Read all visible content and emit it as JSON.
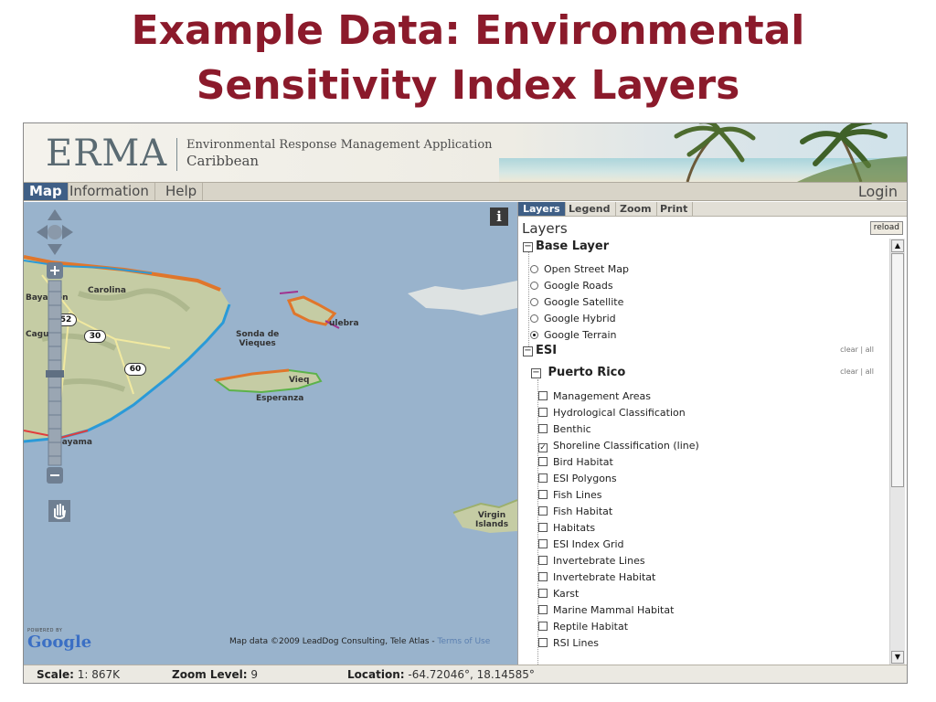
{
  "slide": {
    "title_line1": "Example Data: Environmental",
    "title_line2": "Sensitivity Index Layers"
  },
  "header": {
    "logo": "ERMA",
    "subtitle_line1": "Environmental Response Management Application",
    "subtitle_line2": "Caribbean"
  },
  "nav": {
    "tabs": [
      {
        "label": "Map",
        "active": true
      },
      {
        "label": "Information",
        "active": false
      },
      {
        "label": "Help",
        "active": false
      }
    ],
    "login": "Login"
  },
  "map": {
    "labels": {
      "carolina": "Carolina",
      "bayamon": "Bayamón",
      "caguas": "Caguas",
      "guayama": "Guayama",
      "sonda": "Sonda de",
      "vieques_water": "Vieques",
      "culebra": "ulebra",
      "vieques_island": "Vieq",
      "esperanza": "Esperanza",
      "virgin": "Virgin",
      "islands": "Islands"
    },
    "shields": {
      "r52": "52",
      "r30": "30",
      "r60": "60"
    },
    "attribution": "Map data ©2009 LeadDog Consulting, Tele Atlas - ",
    "terms": "Terms of Use",
    "powered_by": "POWERED BY",
    "google": "Google",
    "info": "i",
    "colors": {
      "water": "#99b3cc",
      "land": "#c9cfa9",
      "accent": "#3f5f86"
    }
  },
  "panel": {
    "tabs": [
      {
        "label": "Layers",
        "active": true
      },
      {
        "label": "Legend",
        "active": false
      },
      {
        "label": "Zoom",
        "active": false
      },
      {
        "label": "Print",
        "active": false
      }
    ],
    "title": "Layers",
    "reload": "reload",
    "base_layer": {
      "heading": "Base Layer",
      "toggle": "−",
      "options": [
        {
          "label": "Open Street Map",
          "selected": false
        },
        {
          "label": "Google Roads",
          "selected": false
        },
        {
          "label": "Google Satellite",
          "selected": false
        },
        {
          "label": "Google Hybrid",
          "selected": false
        },
        {
          "label": "Google Terrain",
          "selected": true
        }
      ]
    },
    "esi": {
      "heading": "ESI",
      "toggle": "−",
      "clear": "clear",
      "sep": "|",
      "all": "all"
    },
    "puerto_rico": {
      "heading": "Puerto Rico",
      "toggle": "−",
      "clear": "clear",
      "sep": "|",
      "all": "all",
      "layers": [
        {
          "label": "Management Areas",
          "checked": false
        },
        {
          "label": "Hydrological Classification",
          "checked": false
        },
        {
          "label": "Benthic",
          "checked": false
        },
        {
          "label": "Shoreline Classification (line)",
          "checked": true
        },
        {
          "label": "Bird Habitat",
          "checked": false
        },
        {
          "label": "ESI Polygons",
          "checked": false
        },
        {
          "label": "Fish Lines",
          "checked": false
        },
        {
          "label": "Fish Habitat",
          "checked": false
        },
        {
          "label": "Habitats",
          "checked": false
        },
        {
          "label": "ESI Index Grid",
          "checked": false
        },
        {
          "label": "Invertebrate Lines",
          "checked": false
        },
        {
          "label": "Invertebrate Habitat",
          "checked": false
        },
        {
          "label": "Karst",
          "checked": false
        },
        {
          "label": "Marine Mammal Habitat",
          "checked": false
        },
        {
          "label": "Reptile Habitat",
          "checked": false
        },
        {
          "label": "RSI Lines",
          "checked": false
        }
      ]
    }
  },
  "status": {
    "scale_label": "Scale:",
    "scale_value": "1: 867K",
    "zoom_label": "Zoom Level:",
    "zoom_value": "9",
    "location_label": "Location:",
    "location_value": "-64.72046°, 18.14585°"
  }
}
